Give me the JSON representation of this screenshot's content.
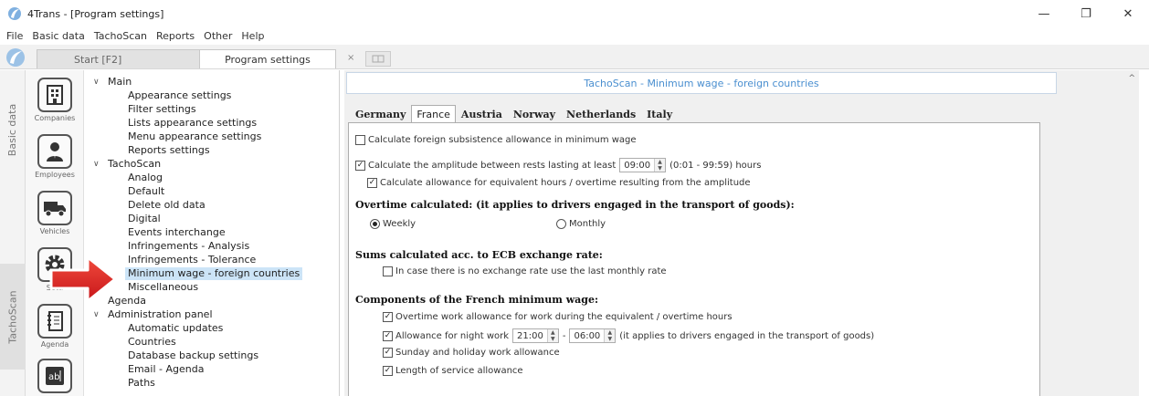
{
  "window": {
    "title": "4Trans - [Program settings]",
    "controls": {
      "minimize": "—",
      "restore": "❐",
      "close": "✕"
    }
  },
  "menu": [
    "File",
    "Basic data",
    "TachoScan",
    "Reports",
    "Other",
    "Help"
  ],
  "tabs": {
    "start": "Start [F2]",
    "program_settings": "Program settings",
    "close": "×"
  },
  "side_tabs": {
    "basic_data": "Basic data",
    "tachoscan": "TachoScan"
  },
  "modules": [
    {
      "label": "Companies",
      "icon": "building-icon"
    },
    {
      "label": "Employees",
      "icon": "person-icon"
    },
    {
      "label": "Vehicles",
      "icon": "truck-icon"
    },
    {
      "label": "Setti",
      "icon": "gear-icon"
    },
    {
      "label": "Agenda",
      "icon": "notebook-icon"
    },
    {
      "label": "",
      "icon": "textbox-icon"
    }
  ],
  "tree": {
    "main": "Main",
    "appearance": "Appearance settings",
    "filter": "Filter settings",
    "lists": "Lists appearance settings",
    "menu": "Menu appearance settings",
    "reports": "Reports settings",
    "tachoscan": "TachoScan",
    "analog": "Analog",
    "default": "Default",
    "delete_old": "Delete old data",
    "digital": "Digital",
    "events": "Events interchange",
    "infr_analysis": "Infringements - Analysis",
    "infr_tolerance": "Infringements - Tolerance",
    "min_wage": "Minimum wage - foreign countries",
    "misc": "Miscellaneous",
    "agenda": "Agenda",
    "admin": "Administration panel",
    "auto_updates": "Automatic updates",
    "countries": "Countries",
    "db_backup": "Database backup settings",
    "email": "Email - Agenda",
    "paths": "Paths"
  },
  "header": "TachoScan - Minimum wage - foreign countries",
  "country_tabs": [
    "Germany",
    "France",
    "Austria",
    "Norway",
    "Netherlands",
    "Italy"
  ],
  "settings": {
    "foreign_subsistence": "Calculate foreign subsistence allowance in minimum wage",
    "amplitude_label": "Calculate the amplitude between rests lasting at least",
    "amplitude_value": "09:00",
    "amplitude_hint": "(0:01 - 99:59) hours",
    "equiv_hours": "Calculate allowance for equivalent hours / overtime resulting from the amplitude",
    "overtime_title": "Overtime calculated: (it applies to drivers engaged in the transport of goods):",
    "weekly": "Weekly",
    "monthly": "Monthly",
    "ecb_title": "Sums calculated acc. to ECB exchange rate:",
    "ecb_option": "In case there is no exchange rate use the last monthly rate",
    "components_title": "Components of the French minimum wage:",
    "overtime_work": "Overtime work allowance for work during the equivalent / overtime hours",
    "night_label": "Allowance for night work",
    "night_from": "21:00",
    "night_dash": "-",
    "night_to": "06:00",
    "night_hint": "(it applies to drivers engaged in the transport of goods)",
    "sunday": "Sunday and holiday work allowance",
    "service": "Length of service allowance"
  }
}
